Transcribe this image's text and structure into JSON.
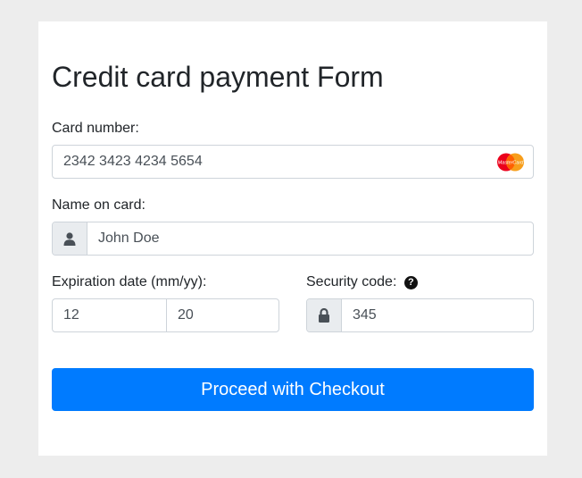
{
  "form": {
    "title": "Credit card payment Form",
    "card_number": {
      "label": "Card number:",
      "value": "2342 3423 4234 5654",
      "brand_icon": "mastercard-icon",
      "brand_text": "MasterCard"
    },
    "name_on_card": {
      "label": "Name on card:",
      "value": "John Doe",
      "icon": "user-icon"
    },
    "expiration": {
      "label": "Expiration date (mm/yy):",
      "month": "12",
      "year": "20"
    },
    "security_code": {
      "label": "Security code:",
      "help_icon": "question-circle-icon",
      "value": "345",
      "icon": "lock-icon"
    },
    "submit_label": "Proceed with Checkout"
  },
  "colors": {
    "page_background": "#ededed",
    "card_background": "#ffffff",
    "primary_button": "#007bff",
    "input_border": "#ced4da",
    "addon_background": "#e9ecef",
    "mastercard_red": "#eb001b",
    "mastercard_orange": "#f79e1b"
  }
}
